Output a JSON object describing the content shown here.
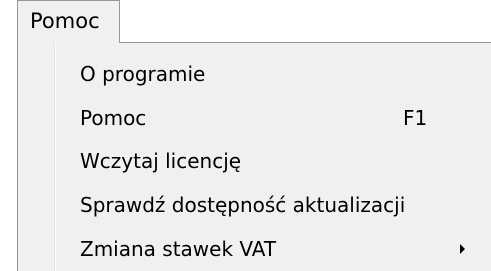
{
  "menubar": {
    "active_menu_label": "Pomoc"
  },
  "dropdown": {
    "items": [
      {
        "label": "O programie",
        "shortcut": "",
        "has_submenu": false
      },
      {
        "label": "Pomoc",
        "shortcut": "F1",
        "has_submenu": false
      },
      {
        "label": "Wczytaj licencję",
        "shortcut": "",
        "has_submenu": false
      },
      {
        "label": "Sprawdź dostępność aktualizacji",
        "shortcut": "",
        "has_submenu": false
      },
      {
        "label": "Zmiana stawek VAT",
        "shortcut": "",
        "has_submenu": true
      }
    ],
    "submenu_icon": "chevron-right-icon"
  }
}
